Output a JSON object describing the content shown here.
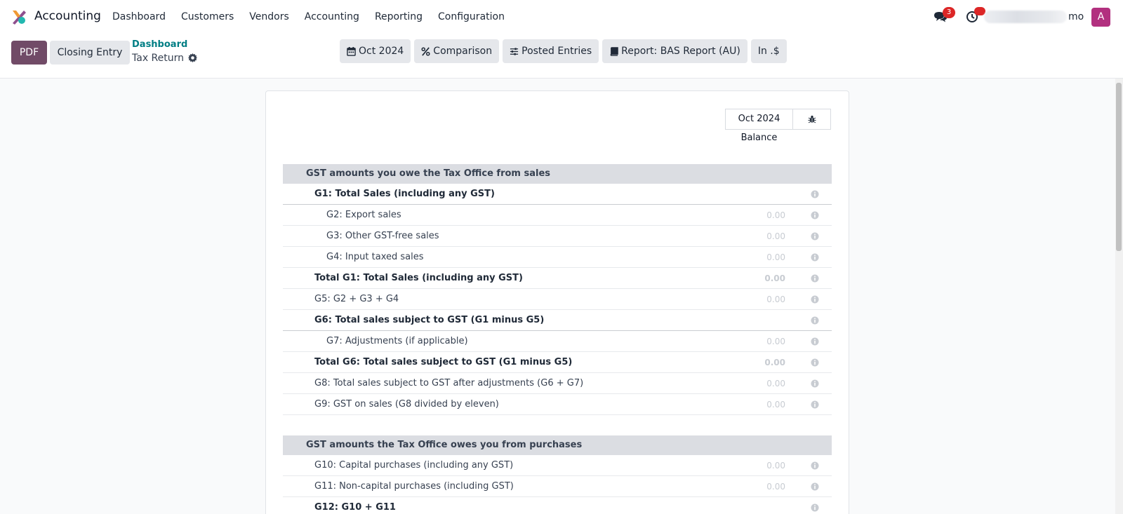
{
  "topnav": {
    "app_name": "Accounting",
    "menu": [
      "Dashboard",
      "Customers",
      "Vendors",
      "Accounting",
      "Reporting",
      "Configuration"
    ],
    "message_count": "3",
    "company_suffix": "mo",
    "avatar_letter": "A"
  },
  "control": {
    "pdf_label": "PDF",
    "closing_label": "Closing Entry",
    "breadcrumb_link": "Dashboard",
    "breadcrumb_current": "Tax Return",
    "filters": {
      "date": "Oct 2024",
      "comparison": "Comparison",
      "posted": "Posted Entries",
      "report": "Report: BAS Report (AU)",
      "currency": "In .$"
    }
  },
  "report": {
    "column_date": "Oct 2024",
    "column_subtitle": "Balance",
    "sections": [
      {
        "title": "GST amounts you owe the Tax Office from sales",
        "rows": [
          {
            "label": "G1: Total Sales (including any GST)",
            "value": ""
          },
          {
            "label": "G2: Export sales",
            "value": "0.00"
          },
          {
            "label": "G3: Other GST-free sales",
            "value": "0.00"
          },
          {
            "label": "G4: Input taxed sales",
            "value": "0.00"
          },
          {
            "label": "Total G1: Total Sales (including any GST)",
            "value": "0.00"
          },
          {
            "label": "G5: G2 + G3 + G4",
            "value": "0.00"
          },
          {
            "label": "G6: Total sales subject to GST (G1 minus G5)",
            "value": ""
          },
          {
            "label": "G7: Adjustments (if applicable)",
            "value": "0.00"
          },
          {
            "label": "Total G6: Total sales subject to GST (G1 minus G5)",
            "value": "0.00"
          },
          {
            "label": "G8: Total sales subject to GST after adjustments (G6 + G7)",
            "value": "0.00"
          },
          {
            "label": "G9: GST on sales (G8 divided by eleven)",
            "value": "0.00"
          }
        ]
      },
      {
        "title": "GST amounts the Tax Office owes you from purchases",
        "rows": [
          {
            "label": "G10: Capital purchases (including any GST)",
            "value": "0.00"
          },
          {
            "label": "G11: Non-capital purchases (including GST)",
            "value": "0.00"
          },
          {
            "label": "G12: G10 + G11",
            "value": ""
          }
        ]
      }
    ]
  },
  "colors": {
    "brand": "#714b67",
    "link": "#017e84",
    "avatar": "#b2307f",
    "badge": "#dc2626"
  }
}
